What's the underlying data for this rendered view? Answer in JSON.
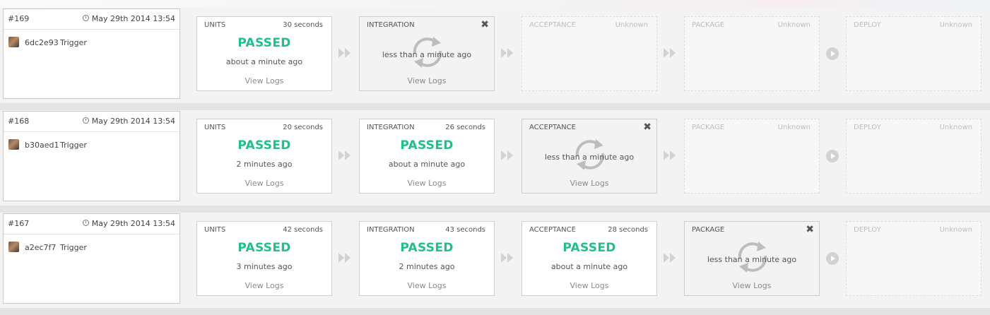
{
  "builds": [
    {
      "number": "#169",
      "date": "May 29th 2014 13:54",
      "commit": "6dc2e93",
      "trigger": "Trigger",
      "stages": [
        {
          "name": "UNITS",
          "duration": "30 seconds",
          "status": "PASSED",
          "time": "about a minute ago",
          "logs": "View Logs"
        },
        {
          "name": "INTEGRATION",
          "duration": "",
          "status": "",
          "time": "less than a minute ago",
          "logs": "View Logs"
        },
        {
          "name": "ACCEPTANCE",
          "duration": "Unknown",
          "status": "",
          "time": "",
          "logs": ""
        },
        {
          "name": "PACKAGE",
          "duration": "Unknown",
          "status": "",
          "time": "",
          "logs": ""
        },
        {
          "name": "DEPLOY",
          "duration": "Unknown",
          "status": "",
          "time": "",
          "logs": ""
        }
      ]
    },
    {
      "number": "#168",
      "date": "May 29th 2014 13:54",
      "commit": "b30aed1",
      "trigger": "Trigger",
      "stages": [
        {
          "name": "UNITS",
          "duration": "20 seconds",
          "status": "PASSED",
          "time": "2 minutes ago",
          "logs": "View Logs"
        },
        {
          "name": "INTEGRATION",
          "duration": "26 seconds",
          "status": "PASSED",
          "time": "about a minute ago",
          "logs": "View Logs"
        },
        {
          "name": "ACCEPTANCE",
          "duration": "",
          "status": "",
          "time": "less than a minute ago",
          "logs": "View Logs"
        },
        {
          "name": "PACKAGE",
          "duration": "Unknown",
          "status": "",
          "time": "",
          "logs": ""
        },
        {
          "name": "DEPLOY",
          "duration": "Unknown",
          "status": "",
          "time": "",
          "logs": ""
        }
      ]
    },
    {
      "number": "#167",
      "date": "May 29th 2014 13:54",
      "commit": "a2ec7f7",
      "trigger": "Trigger",
      "stages": [
        {
          "name": "UNITS",
          "duration": "42 seconds",
          "status": "PASSED",
          "time": "3 minutes ago",
          "logs": "View Logs"
        },
        {
          "name": "INTEGRATION",
          "duration": "43 seconds",
          "status": "PASSED",
          "time": "2 minutes ago",
          "logs": "View Logs"
        },
        {
          "name": "ACCEPTANCE",
          "duration": "28 seconds",
          "status": "PASSED",
          "time": "about a minute ago",
          "logs": "View Logs"
        },
        {
          "name": "PACKAGE",
          "duration": "",
          "status": "",
          "time": "less than a minute ago",
          "logs": "View Logs"
        },
        {
          "name": "DEPLOY",
          "duration": "Unknown",
          "status": "",
          "time": "",
          "logs": ""
        }
      ]
    }
  ],
  "icons": {
    "close": "close-icon",
    "running": "refresh-icon",
    "next": "fast-forward-icon",
    "deploy": "play-icon",
    "date": "clock-icon"
  },
  "colors": {
    "passed": "#1fbf8f",
    "running_bg": "#f3f3f3",
    "unknown_text": "#bdbdbd"
  }
}
